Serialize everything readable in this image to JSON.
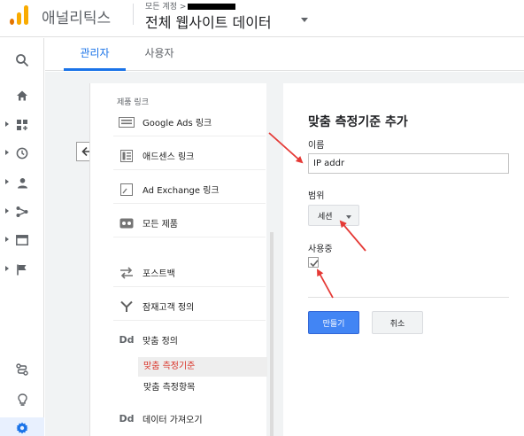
{
  "header": {
    "app_name": "애널리틱스",
    "account_path": "모든 계정 >",
    "view_name": "전체 웹사이트 데이터"
  },
  "tabs": [
    {
      "label": "관리자",
      "active": true
    },
    {
      "label": "사용자",
      "active": false
    }
  ],
  "rail": [
    {
      "icon": "search-icon"
    },
    {
      "icon": "home-icon"
    },
    {
      "icon": "dashboard-icon"
    },
    {
      "icon": "clock-icon"
    },
    {
      "icon": "person-icon"
    },
    {
      "icon": "acquisition-icon"
    },
    {
      "icon": "behavior-icon"
    },
    {
      "icon": "flag-icon"
    },
    {
      "icon": "discover-icon"
    },
    {
      "icon": "lightbulb-icon"
    },
    {
      "icon": "gear-icon"
    }
  ],
  "nav": {
    "section_label": "제품 링크",
    "items": [
      {
        "label": "Google Ads 링크",
        "icon": "google-ads-icon"
      },
      {
        "label": "애드센스 링크",
        "icon": "adsense-icon"
      },
      {
        "label": "Ad Exchange 링크",
        "icon": "ad-exchange-icon"
      },
      {
        "label": "모든 제품",
        "icon": "all-products-icon"
      },
      {
        "label": "포스트백",
        "icon": "postback-icon"
      },
      {
        "label": "잠재고객 정의",
        "icon": "audience-icon"
      },
      {
        "label": "맞춤 정의",
        "icon": "custom-definitions-icon"
      }
    ],
    "sub_items": [
      {
        "label": "맞춤 측정기준",
        "selected": true
      },
      {
        "label": "맞춤 측정항목",
        "selected": false
      }
    ],
    "last_item": {
      "label": "데이터 가져오기",
      "icon": "data-import-icon"
    }
  },
  "form": {
    "title": "맞춤 측정기준 추가",
    "name_label": "이름",
    "name_value": "IP addr",
    "scope_label": "범위",
    "scope_value": "세션",
    "active_label": "사용중",
    "active_checked": true,
    "create_label": "만들기",
    "cancel_label": "취소"
  },
  "colors": {
    "accent": "#1a73e8",
    "primary_button": "#4285f4",
    "selected_sub_text": "#d93025",
    "annotation_arrow": "#e53935"
  }
}
